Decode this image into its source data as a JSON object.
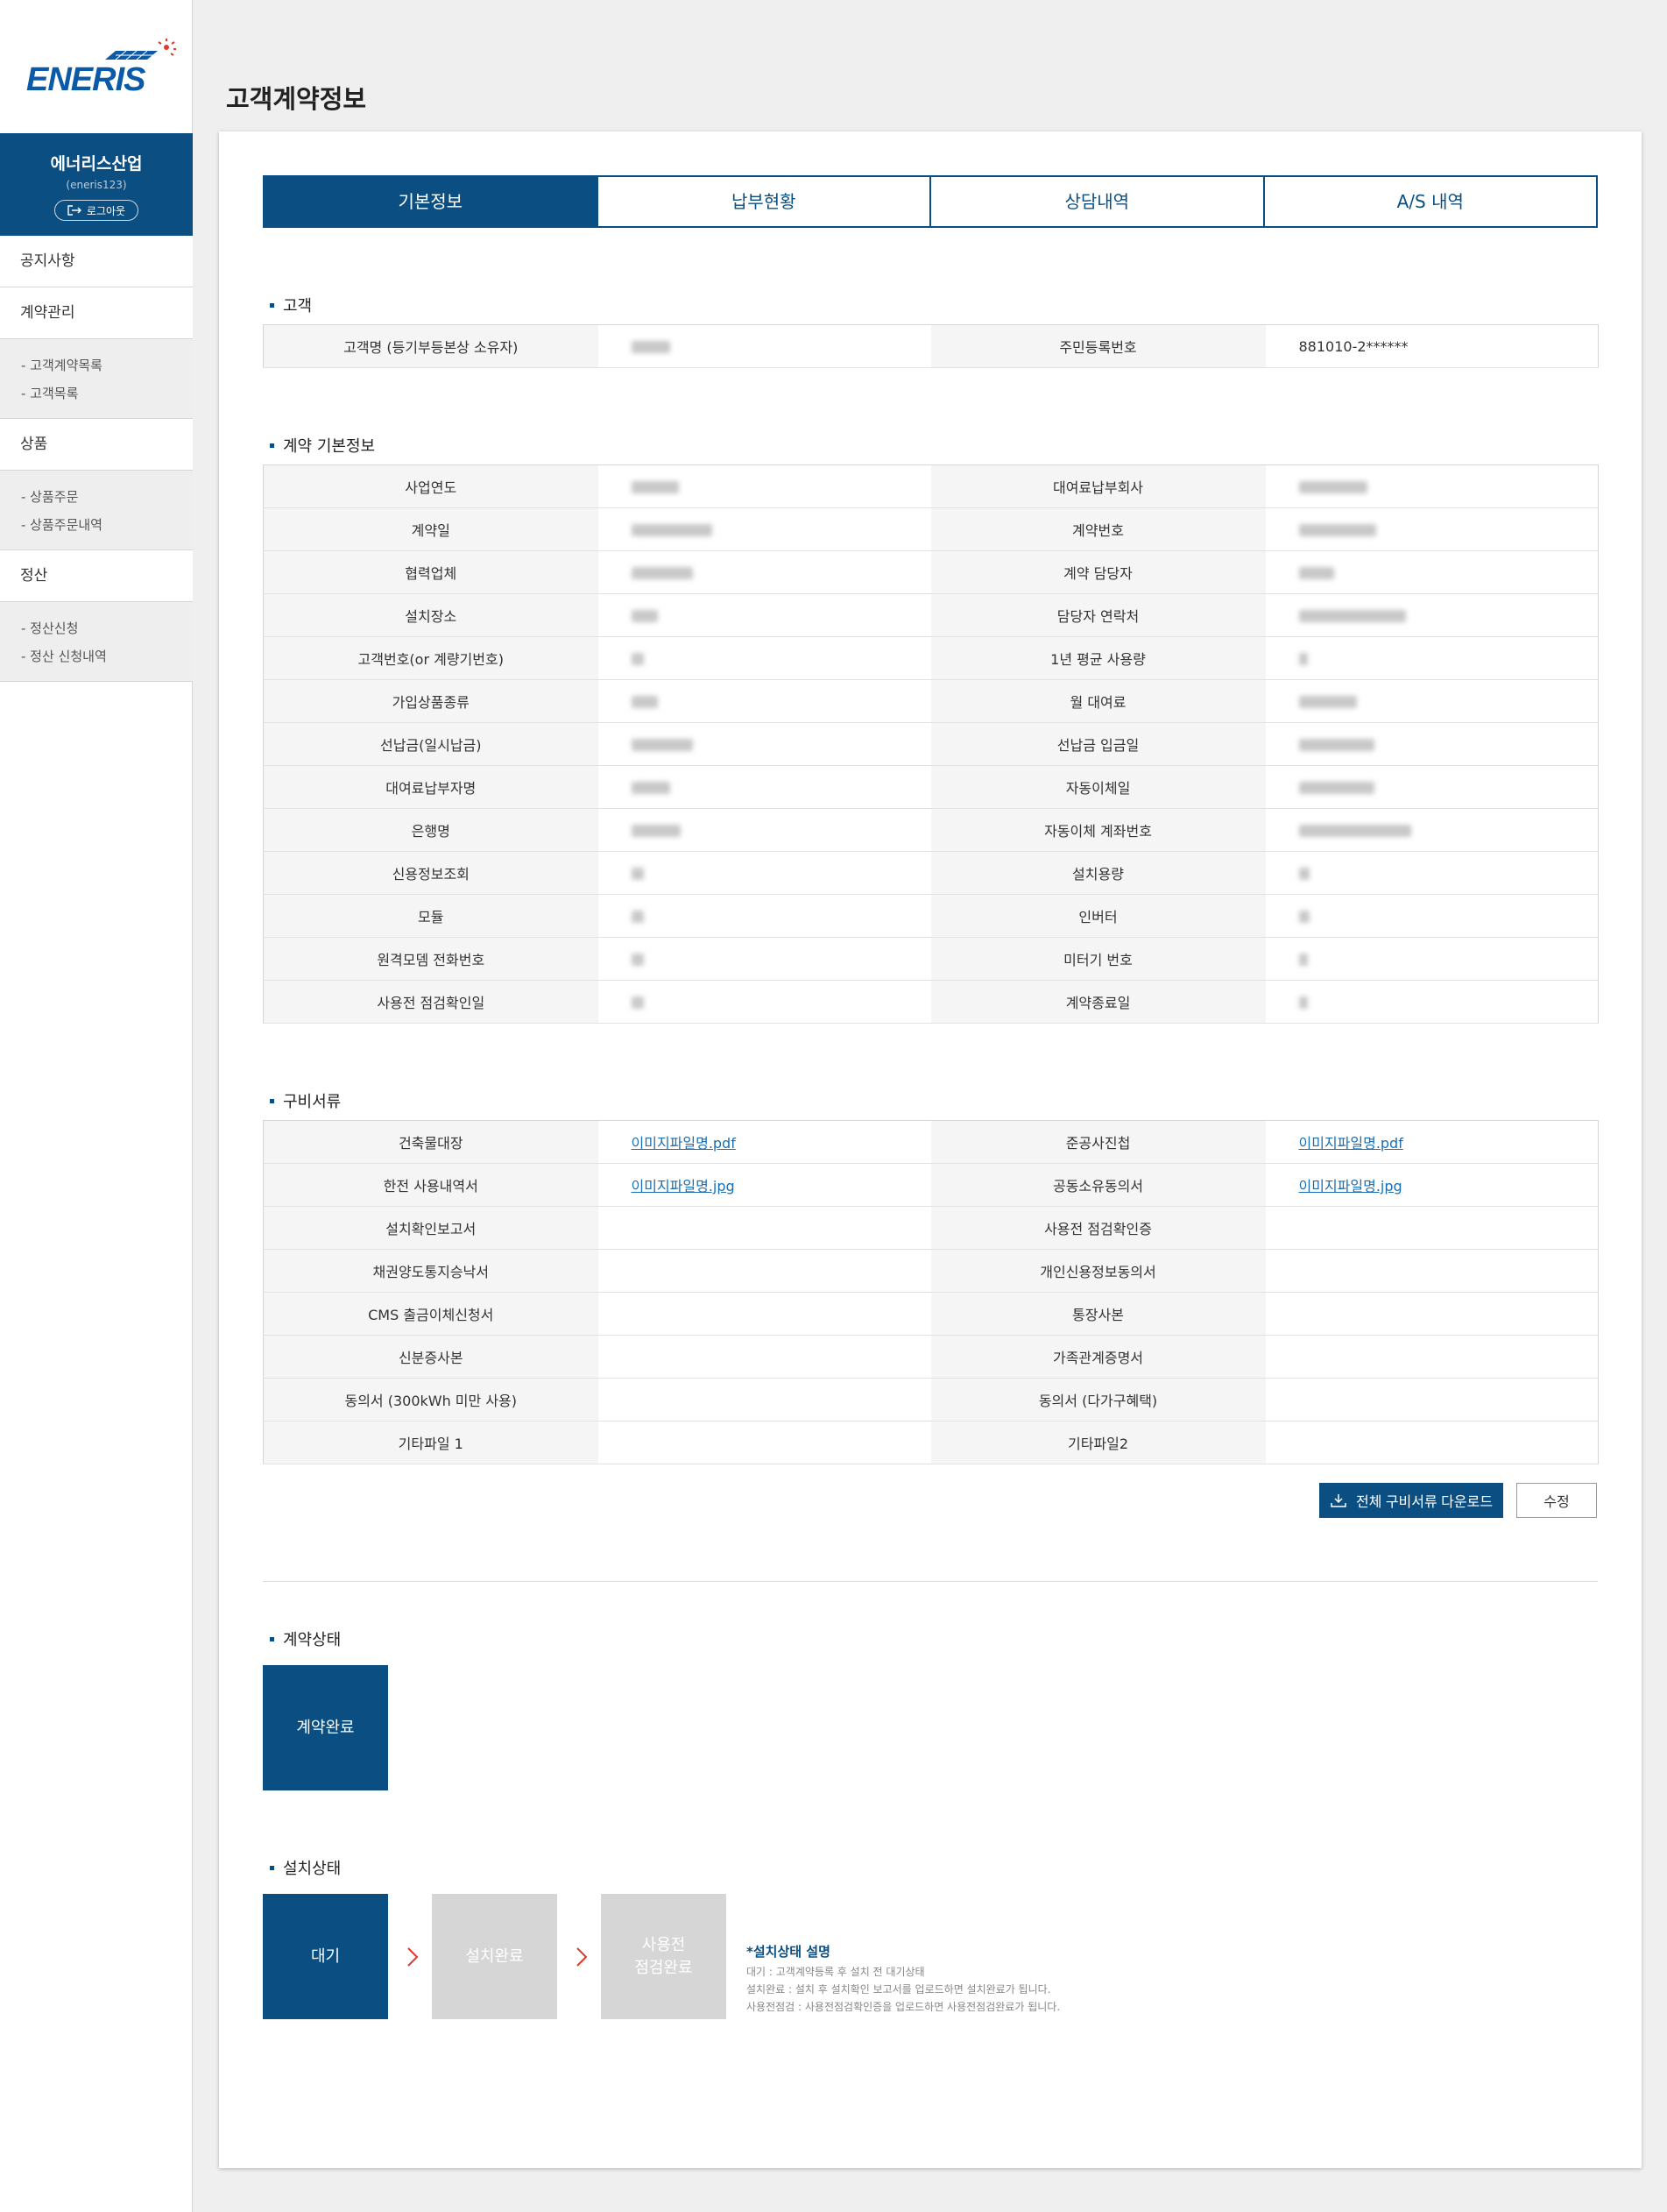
{
  "brand": {
    "logo_text": "ENERIS"
  },
  "profile": {
    "company": "에너리스산업",
    "user_id": "(eneris123)",
    "logout_label": "로그아웃"
  },
  "nav": {
    "notice": "공지사항",
    "contract": {
      "label": "계약관리",
      "items": [
        "- 고객계약목록",
        "- 고객목록"
      ]
    },
    "product": {
      "label": "상품",
      "items": [
        "- 상품주문",
        "- 상품주문내역"
      ]
    },
    "settlement": {
      "label": "정산",
      "items": [
        "- 정산신청",
        "- 정산 신청내역"
      ]
    }
  },
  "page_title": "고객계약정보",
  "tabs": [
    "기본정보",
    "납부현황",
    "상담내역",
    "A/S 내역"
  ],
  "customer": {
    "section_title": "고객",
    "name_label": "고객명 (등기부등본상 소유자)",
    "rrn_label": "주민등록번호",
    "rrn_value": "881010-2******"
  },
  "contract_info": {
    "section_title": "계약 기본정보",
    "rows": [
      [
        "사업연도",
        "대여료납부회사"
      ],
      [
        "계약일",
        "계약번호"
      ],
      [
        "협력업체",
        "계약 담당자"
      ],
      [
        "설치장소",
        "담당자 연락처"
      ],
      [
        "고객번호(or 계량기번호)",
        "1년 평균 사용량"
      ],
      [
        "가입상품종류",
        "월 대여료"
      ],
      [
        "선납금(일시납금)",
        "선납금 입금일"
      ],
      [
        "대여료납부자명",
        "자동이체일"
      ],
      [
        "은행명",
        "자동이체 계좌번호"
      ],
      [
        "신용정보조회",
        "설치용량"
      ],
      [
        "모듈",
        "인버터"
      ],
      [
        "원격모뎀 전화번호",
        "미터기 번호"
      ],
      [
        "사용전 점검확인일",
        "계약종료일"
      ]
    ]
  },
  "documents": {
    "section_title": "구비서류",
    "rows": [
      {
        "l": "건축물대장",
        "lv": "이미지파일명.pdf",
        "r": "준공사진첩",
        "rv": "이미지파일명.pdf"
      },
      {
        "l": "한전 사용내역서",
        "lv": "이미지파일명.jpg",
        "r": "공동소유동의서",
        "rv": "이미지파일명.jpg"
      },
      {
        "l": "설치확인보고서",
        "lv": "",
        "r": "사용전 점검확인증",
        "rv": ""
      },
      {
        "l": "채권양도통지승낙서",
        "lv": "",
        "r": "개인신용정보동의서",
        "rv": ""
      },
      {
        "l": "CMS 출금이체신청서",
        "lv": "",
        "r": "통장사본",
        "rv": ""
      },
      {
        "l": "신분증사본",
        "lv": "",
        "r": "가족관계증명서",
        "rv": ""
      },
      {
        "l": "동의서 (300kWh 미만 사용)",
        "lv": "",
        "r": "동의서 (다가구혜택)",
        "rv": ""
      },
      {
        "l": "기타파일 1",
        "lv": "",
        "r": "기타파일2",
        "rv": ""
      }
    ],
    "download_label": "전체 구비서류 다운로드",
    "edit_label": "수정"
  },
  "contract_status": {
    "section_title": "계약상태",
    "value": "계약완료"
  },
  "install_status": {
    "section_title": "설치상태",
    "steps": [
      "대기",
      "설치완료",
      "사용전\n점검완료"
    ],
    "active_index": 0,
    "legend_title": "*설치상태 설명",
    "legend_lines": [
      "대기 : 고객계약등록 후 설치 전 대기상태",
      "설치완료 : 설치 후 설치확인 보고서를 업로드하면 설치완료가 됩니다.",
      "사용전점검 : 사용전점검확인증을 업로드하면 사용전점검완료가 됩니다."
    ]
  },
  "colors": {
    "primary": "#0b4f82",
    "link": "#1a6fb4",
    "inactive": "#d6d6d6"
  }
}
